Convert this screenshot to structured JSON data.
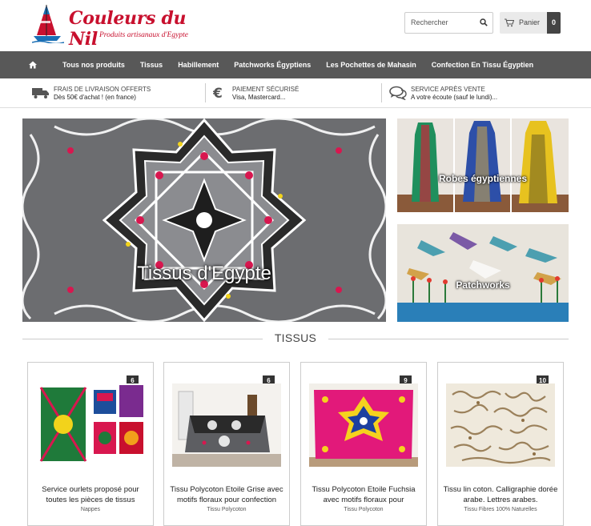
{
  "header": {
    "logo_title": "Couleurs du Nil",
    "logo_subtitle": "Produits artisanaux d'Egypte",
    "search_placeholder": "Rechercher",
    "cart_label": "Panier",
    "cart_count": "0"
  },
  "nav": {
    "items": [
      {
        "label": "Tous nos produits"
      },
      {
        "label": "Tissus"
      },
      {
        "label": "Habillement"
      },
      {
        "label": "Patchworks Égyptiens"
      },
      {
        "label": "Les Pochettes de Mahasin"
      },
      {
        "label": "Confection En Tissu Égyptien"
      }
    ]
  },
  "features": [
    {
      "title": "FRAIS DE LIVRAISON OFFERTS",
      "subtitle": "Dès 50€ d'achat ! (en france)",
      "icon": "truck-icon"
    },
    {
      "title": "PAIEMENT SÉCURISÉ",
      "subtitle": "Visa, Mastercard...",
      "icon": "euro-icon"
    },
    {
      "title": "SERVICE APRÈS VENTE",
      "subtitle": "A votre écoute (sauf le lundi)...",
      "icon": "chat-icon"
    }
  ],
  "banners": {
    "main_caption": "Tissus d'Egypte",
    "robes_caption": "Robes égyptiennes",
    "patchworks_caption": "Patchworks"
  },
  "section": {
    "title": "TISSUS"
  },
  "products": [
    {
      "badge": "6",
      "title": "Service ourlets proposé pour toutes les pièces de tissus",
      "category": "Nappes"
    },
    {
      "badge": "6",
      "title": "Tissu Polycoton Etoile Grise avec motifs floraux pour confection",
      "category": "Tissu Polycoton"
    },
    {
      "badge": "9",
      "title": "Tissu Polycoton Etoile Fuchsia avec motifs floraux pour",
      "category": "Tissu Polycoton"
    },
    {
      "badge": "10",
      "title": "Tissu lin coton. Calligraphie dorée arabe. Lettres arabes.",
      "category": "Tissu Fibres 100% Naturelles"
    }
  ],
  "colors": {
    "brand_red": "#c8102e",
    "nav_bg": "#585858",
    "badge_bg": "#333333"
  }
}
